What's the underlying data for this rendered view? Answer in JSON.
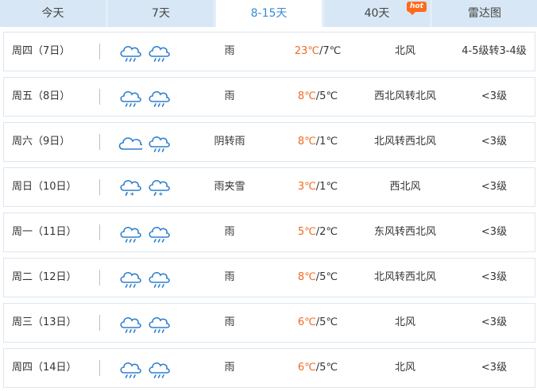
{
  "tabs": [
    {
      "label": "今天"
    },
    {
      "label": "7天"
    },
    {
      "label": "8-15天"
    },
    {
      "label": "40天",
      "badge": "hot"
    },
    {
      "label": "雷达图"
    }
  ],
  "active_tab": "8-15天",
  "colors": {
    "high_temp": "#f06b22",
    "active_tab": "#3a8ad6",
    "hot_badge": "#ff6a1a"
  },
  "forecast": [
    {
      "date": "周四（7日）",
      "icons": [
        "rain-cloud-icon",
        "rain-cloud-icon"
      ],
      "condition": "雨",
      "high": "23℃",
      "low": "/7℃",
      "wind": "北风",
      "level": "4-5级转3-4级"
    },
    {
      "date": "周五（8日）",
      "icons": [
        "rain-cloud-icon",
        "rain-cloud-icon"
      ],
      "condition": "雨",
      "high": "8℃",
      "low": "/5℃",
      "wind": "西北风转北风",
      "level": "<3级"
    },
    {
      "date": "周六（9日）",
      "icons": [
        "overcast-cloud-icon",
        "rain-cloud-icon"
      ],
      "condition": "阴转雨",
      "high": "8℃",
      "low": "/1℃",
      "wind": "北风转西北风",
      "level": "<3级"
    },
    {
      "date": "周日（10日）",
      "icons": [
        "sleet-cloud-icon",
        "sleet-cloud-icon"
      ],
      "condition": "雨夹雪",
      "high": "3℃",
      "low": "/1℃",
      "wind": "西北风",
      "level": "<3级"
    },
    {
      "date": "周一（11日）",
      "icons": [
        "rain-cloud-icon",
        "rain-cloud-icon"
      ],
      "condition": "雨",
      "high": "5℃",
      "low": "/2℃",
      "wind": "东风转西北风",
      "level": "<3级"
    },
    {
      "date": "周二（12日）",
      "icons": [
        "rain-cloud-icon",
        "rain-cloud-icon"
      ],
      "condition": "雨",
      "high": "8℃",
      "low": "/5℃",
      "wind": "北风转西北风",
      "level": "<3级"
    },
    {
      "date": "周三（13日）",
      "icons": [
        "rain-cloud-icon",
        "rain-cloud-icon"
      ],
      "condition": "雨",
      "high": "6℃",
      "low": "/5℃",
      "wind": "北风",
      "level": "<3级"
    },
    {
      "date": "周四（14日）",
      "icons": [
        "rain-cloud-icon",
        "rain-cloud-icon"
      ],
      "condition": "雨",
      "high": "6℃",
      "low": "/5℃",
      "wind": "北风",
      "level": "<3级"
    }
  ]
}
